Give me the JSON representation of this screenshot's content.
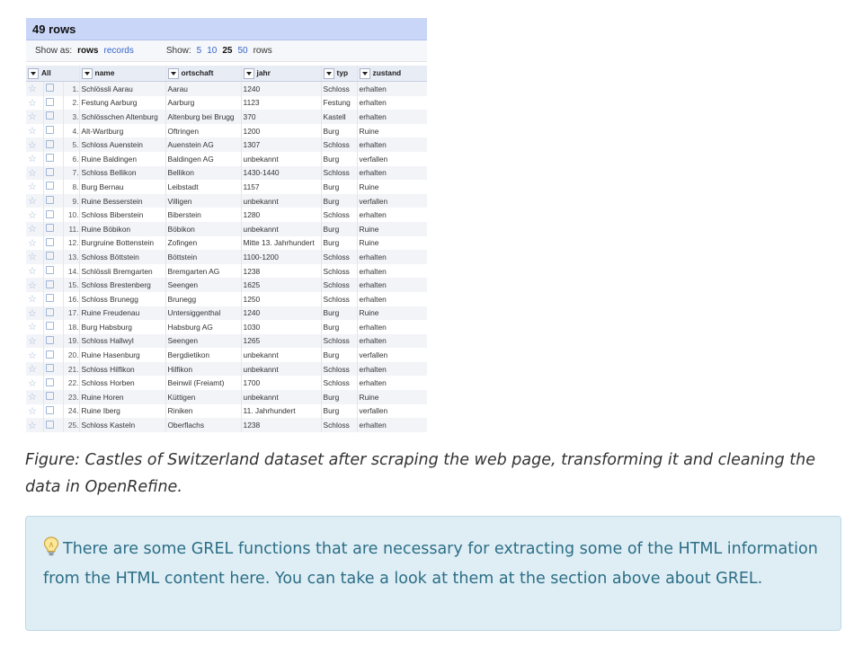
{
  "screenshot": {
    "row_count_label": "49 rows",
    "show_as_label": "Show as:",
    "show_as_selected": "rows",
    "show_as_other": "records",
    "show_label": "Show:",
    "page_sizes": [
      "5",
      "10",
      "25",
      "50"
    ],
    "page_size_selected": "25",
    "rows_suffix": "rows",
    "columns": [
      "All",
      "name",
      "ortschaft",
      "jahr",
      "typ",
      "zustand"
    ],
    "rows": [
      [
        "1.",
        "Schlössli Aarau",
        "Aarau",
        "1240",
        "Schloss",
        "erhalten"
      ],
      [
        "2.",
        "Festung Aarburg",
        "Aarburg",
        "1123",
        "Festung",
        "erhalten"
      ],
      [
        "3.",
        "Schlösschen Altenburg",
        "Altenburg bei Brugg",
        "370",
        "Kastell",
        "erhalten"
      ],
      [
        "4.",
        "Alt-Wartburg",
        "Oftringen",
        "1200",
        "Burg",
        "Ruine"
      ],
      [
        "5.",
        "Schloss Auenstein",
        "Auenstein AG",
        "1307",
        "Schloss",
        "erhalten"
      ],
      [
        "6.",
        "Ruine Baldingen",
        "Baldingen AG",
        "unbekannt",
        "Burg",
        "verfallen"
      ],
      [
        "7.",
        "Schloss Bellikon",
        "Bellikon",
        "1430-1440",
        "Schloss",
        "erhalten"
      ],
      [
        "8.",
        "Burg Bernau",
        "Leibstadt",
        "1157",
        "Burg",
        "Ruine"
      ],
      [
        "9.",
        "Ruine Besserstein",
        "Villigen",
        "unbekannt",
        "Burg",
        "verfallen"
      ],
      [
        "10.",
        "Schloss Biberstein",
        "Biberstein",
        "1280",
        "Schloss",
        "erhalten"
      ],
      [
        "11.",
        "Ruine Böbikon",
        "Böbikon",
        "unbekannt",
        "Burg",
        "Ruine"
      ],
      [
        "12.",
        "Burgruine Bottenstein",
        "Zofingen",
        "Mitte 13. Jahrhundert",
        "Burg",
        "Ruine"
      ],
      [
        "13.",
        "Schloss Böttstein",
        "Böttstein",
        "1100-1200",
        "Schloss",
        "erhalten"
      ],
      [
        "14.",
        "Schlössli Bremgarten",
        "Bremgarten AG",
        "1238",
        "Schloss",
        "erhalten"
      ],
      [
        "15.",
        "Schloss Brestenberg",
        "Seengen",
        "1625",
        "Schloss",
        "erhalten"
      ],
      [
        "16.",
        "Schloss Brunegg",
        "Brunegg",
        "1250",
        "Schloss",
        "erhalten"
      ],
      [
        "17.",
        "Ruine Freudenau",
        "Untersiggenthal",
        "1240",
        "Burg",
        "Ruine"
      ],
      [
        "18.",
        "Burg Habsburg",
        "Habsburg AG",
        "1030",
        "Burg",
        "erhalten"
      ],
      [
        "19.",
        "Schloss Hallwyl",
        "Seengen",
        "1265",
        "Schloss",
        "erhalten"
      ],
      [
        "20.",
        "Ruine Hasenburg",
        "Bergdietikon",
        "unbekannt",
        "Burg",
        "verfallen"
      ],
      [
        "21.",
        "Schloss Hilfikon",
        "Hilfikon",
        "unbekannt",
        "Schloss",
        "erhalten"
      ],
      [
        "22.",
        "Schloss Horben",
        "Beinwil (Freiamt)",
        "1700",
        "Schloss",
        "erhalten"
      ],
      [
        "23.",
        "Ruine Horen",
        "Küttigen",
        "unbekannt",
        "Burg",
        "Ruine"
      ],
      [
        "24.",
        "Ruine Iberg",
        "Riniken",
        "11. Jahrhundert",
        "Burg",
        "verfallen"
      ],
      [
        "25.",
        "Schloss Kasteln",
        "Oberflachs",
        "1238",
        "Schloss",
        "erhalten"
      ]
    ]
  },
  "caption": "Figure: Castles of Switzerland dataset after scraping the web page, transforming it and cleaning the data in OpenRefine.",
  "tip": {
    "icon": "lightbulb-icon",
    "text": "There are some GREL functions that are necessary for extracting some of the HTML information from the HTML content here. You can take a look at them at the section above about GREL."
  },
  "colors": {
    "header_bg": "#c9d6f8",
    "link": "#3366cc",
    "tip_bg": "#dfeef5",
    "tip_text": "#2c6e86"
  }
}
